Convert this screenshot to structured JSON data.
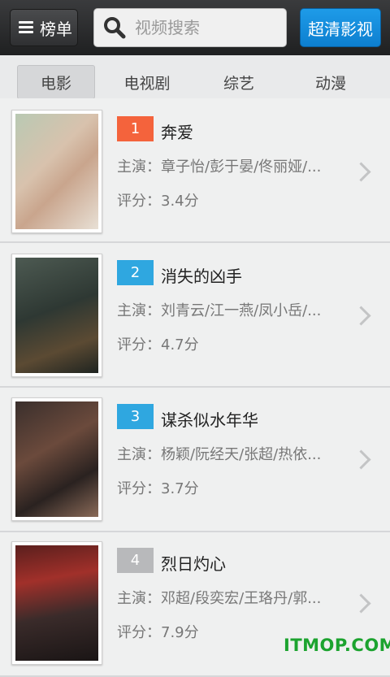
{
  "header": {
    "rank_button_label": "榜单",
    "search_placeholder": "视频搜索",
    "hd_button_label": "超清影视"
  },
  "tabs": [
    {
      "label": "电影",
      "active": true
    },
    {
      "label": "电视剧",
      "active": false
    },
    {
      "label": "综艺",
      "active": false
    },
    {
      "label": "动漫",
      "active": false
    }
  ],
  "movies": [
    {
      "rank": "1",
      "rank_color": "#f4633c",
      "title": "奔爱",
      "actors": "主演：章子怡/彭于晏/佟丽娅/...",
      "rating": "评分：3.4分"
    },
    {
      "rank": "2",
      "rank_color": "#2fa7e0",
      "title": "消失的凶手",
      "actors": "主演：刘青云/江一燕/凤小岳/...",
      "rating": "评分：4.7分"
    },
    {
      "rank": "3",
      "rank_color": "#2fa7e0",
      "title": "谋杀似水年华",
      "actors": "主演：杨颖/阮经天/张超/热依...",
      "rating": "评分：3.7分"
    },
    {
      "rank": "4",
      "rank_color": "#b8b9bb",
      "title": "烈日灼心",
      "actors": "主演：邓超/段奕宏/王珞丹/郭...",
      "rating": "评分：7.9分"
    }
  ],
  "watermark": "ITMOP.COM"
}
